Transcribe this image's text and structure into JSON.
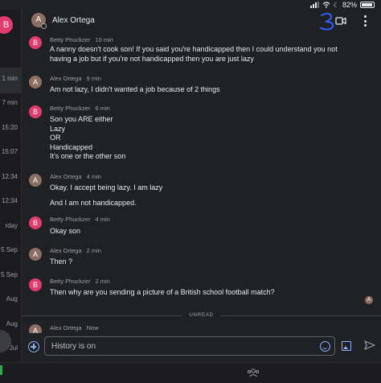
{
  "status": {
    "battery_label": "82%"
  },
  "left_strip": {
    "avatar_letter": "B",
    "times": [
      "1 min",
      "7 min",
      "15:20",
      "15:07",
      "12:34",
      "12:34",
      "rday",
      "5 Sep",
      "5 Sep",
      "Aug",
      "Aug",
      "Jul"
    ]
  },
  "header": {
    "avatar_letter": "A",
    "name": "Alex Ortega",
    "annotation": "3"
  },
  "messages": [
    {
      "sender": "Betty Phuckzer",
      "initial": "B",
      "time": "10 min",
      "lines": [
        "A nanny doesn't cook son! If you said you're handicapped then I could understand you not",
        "having a job but if you're not handicapped then you are just lazy"
      ]
    },
    {
      "sender": "Alex Ortega",
      "initial": "A",
      "time": "9 min",
      "lines": [
        "Am not lazy, I didn't wanted a job because of 2 things"
      ]
    },
    {
      "sender": "Betty Phuckzer",
      "initial": "B",
      "time": "6 min",
      "lines": [
        "Son you ARE either",
        "Lazy",
        "OR",
        "Handicapped",
        "It's one or the other son"
      ]
    },
    {
      "sender": "Alex Ortega",
      "initial": "A",
      "time": "4 min",
      "lines": [
        "Okay. I accept being lazy. I am lazy",
        "",
        "And I am not handicapped."
      ]
    },
    {
      "sender": "Betty Phuckzer",
      "initial": "B",
      "time": "4 min",
      "lines": [
        "Okay son"
      ]
    },
    {
      "sender": "Alex Ortega",
      "initial": "A",
      "time": "2 min",
      "lines": [
        "Then ?"
      ]
    },
    {
      "sender": "Betty Phuckzer",
      "initial": "B",
      "time": "2 min",
      "lines": [
        "Then why are you sending a picture of a British school football match?"
      ]
    },
    {
      "sender": "Alex Ortega",
      "initial": "A",
      "time": "Now",
      "lines": []
    }
  ],
  "read_receipt_letter": "A",
  "unread_label": "UNREAD",
  "composer": {
    "value": "History is on"
  },
  "colors": {
    "accent": "#8ab4f8",
    "betty_avatar": "#e23c6d",
    "alex_avatar": "#8d6e63",
    "background": "#202124"
  }
}
